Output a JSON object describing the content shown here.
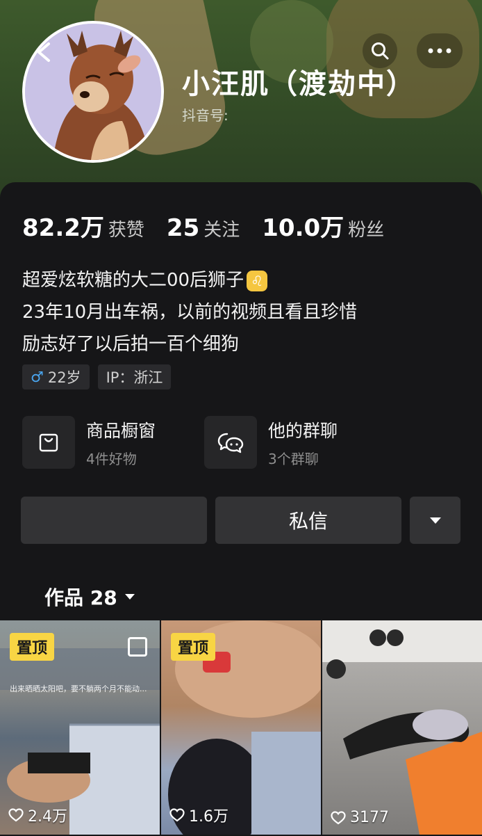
{
  "profile": {
    "name": "小汪肌（渡劫中）",
    "douyin_id_label": "抖音号:"
  },
  "stats": [
    {
      "value": "82.2万",
      "label": "获赞"
    },
    {
      "value": "25",
      "label": "关注"
    },
    {
      "value": "10.0万",
      "label": "粉丝"
    }
  ],
  "bio": {
    "line1": "超爱炫软糖的大二00后狮子",
    "line2": "23年10月出车祸，以前的视频且看且珍惜",
    "line3": "励志好了以后拍一百个细狗",
    "zodiac_icon": "leo-zodiac-icon"
  },
  "tags": {
    "age": "22岁",
    "ip": "IP：浙江"
  },
  "entries": [
    {
      "title": "商品橱窗",
      "subtitle": "4件好物",
      "icon": "bag-icon"
    },
    {
      "title": "他的群聊",
      "subtitle": "3个群聊",
      "icon": "chat-bubbles-icon"
    }
  ],
  "buttons": {
    "follow_label": "",
    "message_label": "私信"
  },
  "tabs": {
    "works_label": "作品 28"
  },
  "videos": [
    {
      "pinned_label": "置顶",
      "likes": "2.4万",
      "caption": "出来晒晒太阳吧，要不躺两个月不能动..."
    },
    {
      "pinned_label": "置顶",
      "likes": "1.6万"
    },
    {
      "likes": "3177"
    }
  ],
  "colors": {
    "background": "#121212",
    "card": "#161618",
    "pin_badge": "#f8d544",
    "male_symbol": "#4aa6f0",
    "zodiac_badge": "#f5c640"
  }
}
